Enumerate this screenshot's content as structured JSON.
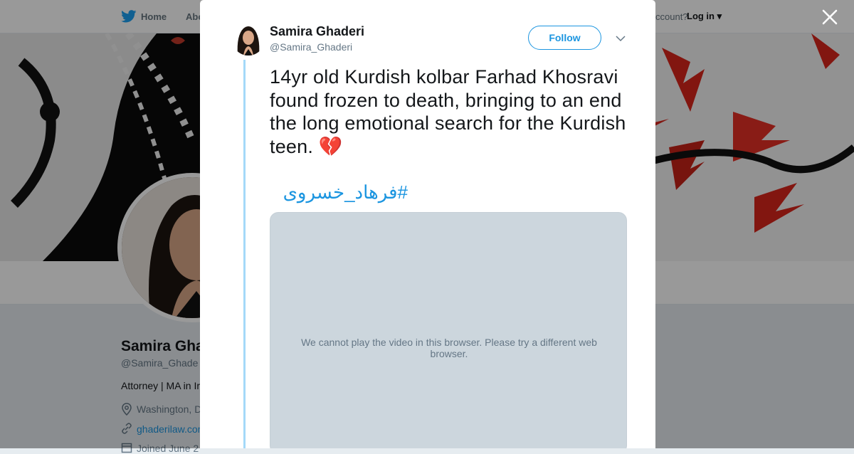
{
  "topbar": {
    "home_label": "Home",
    "about_label": "Abo",
    "account_text": "ccount?",
    "login_label": "Log in"
  },
  "profile": {
    "name": "Samira Gha",
    "handle": "@Samira_Ghade",
    "bio": "Attorney | MA in Ir",
    "location": "Washington, D",
    "link": "ghaderilaw.con",
    "joined": "Joined June 2"
  },
  "tweet": {
    "author_name": "Samira Ghaderi",
    "author_handle": "@Samira_Ghaderi",
    "follow_label": "Follow",
    "text": "14yr old Kurdish kolbar Farhad Khosravi found frozen to death, bringing to an end the long emotional search for the Kurdish teen. 💔",
    "hashtag": "#فرهاد_خسروی",
    "video_message": "We cannot play the video in this browser. Please try a different web browser."
  },
  "colors": {
    "accent": "#1b95e0",
    "thread_line": "#a4d9f9",
    "video_bg": "#ccd6dd"
  },
  "icons": [
    "twitter-bird-icon",
    "close-icon",
    "chevron-down-icon",
    "location-icon",
    "link-icon",
    "calendar-icon"
  ]
}
